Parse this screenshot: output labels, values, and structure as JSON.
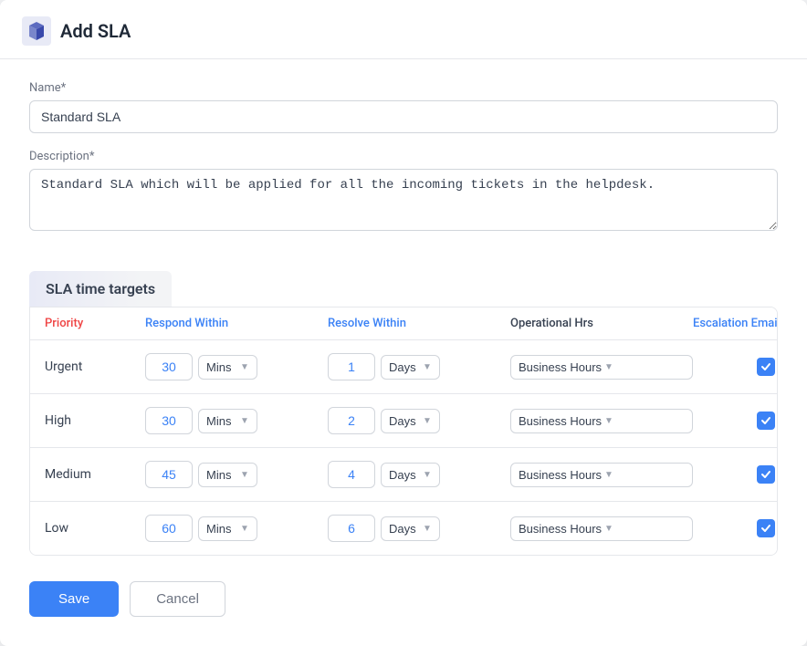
{
  "header": {
    "title": "Add SLA",
    "logo_alt": "logo"
  },
  "form": {
    "name_label": "Name*",
    "name_value": "Standard SLA",
    "description_label": "Description*",
    "description_value": "Standard SLA which will be applied for all the incoming tickets in the helpdesk."
  },
  "sla_section": {
    "title": "SLA time targets",
    "columns": {
      "priority": "Priority",
      "respond_within": "Respond Within",
      "resolve_within": "Resolve Within",
      "operational_hrs": "Operational Hrs",
      "escalation_email": "Escalation Email"
    },
    "rows": [
      {
        "priority": "Urgent",
        "respond_value": "30",
        "respond_unit": "Mins",
        "resolve_value": "1",
        "resolve_unit": "Days",
        "operational": "Business Hours",
        "escalation": true
      },
      {
        "priority": "High",
        "respond_value": "30",
        "respond_unit": "Mins",
        "resolve_value": "2",
        "resolve_unit": "Days",
        "operational": "Business Hours",
        "escalation": true
      },
      {
        "priority": "Medium",
        "respond_value": "45",
        "respond_unit": "Mins",
        "resolve_value": "4",
        "resolve_unit": "Days",
        "operational": "Business Hours",
        "escalation": true
      },
      {
        "priority": "Low",
        "respond_value": "60",
        "respond_unit": "Mins",
        "resolve_value": "6",
        "resolve_unit": "Days",
        "operational": "Business Hours",
        "escalation": true
      }
    ]
  },
  "buttons": {
    "save": "Save",
    "cancel": "Cancel"
  }
}
